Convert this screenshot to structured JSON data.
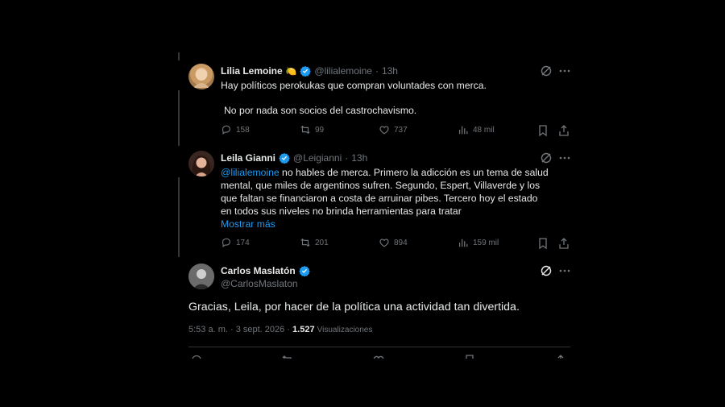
{
  "reply1": {
    "name": "Lilia Lemoine",
    "emoji": "🍋",
    "handle": "@lilialemoine",
    "dot": "·",
    "time": "13h",
    "line1": "Hay políticos perokukas que compran voluntades con merca.",
    "line2": "No por nada son socios del castrochavismo.",
    "replies": "158",
    "retweets": "99",
    "likes": "737",
    "views": "48 mil"
  },
  "reply2": {
    "name": "Leila Gianni",
    "handle": "@Leigianni",
    "dot": "·",
    "time": "13h",
    "mention": "@lilialemoine",
    "line1_rest": " no hables de merca. Primero la adicción es un tema de salud",
    "line2": "mental, que miles de argentinos sufren. Segundo, Espert, Villaverde y los",
    "line3": "que faltan se financiaron a costa de arruinar pibes. Tercero hoy el estado",
    "line4": "en todos sus niveles no brinda herramientas para tratar",
    "show_more": "Mostrar más",
    "replies": "174",
    "retweets": "201",
    "likes": "894",
    "views": "159 mil"
  },
  "main": {
    "name": "Carlos Maslatón",
    "handle": "@CarlosMaslaton",
    "text": "Gracias, Leila, por hacer de la política una actividad tan divertida.",
    "timestamp": "5:53 a. m. · 3 sept. 2026 ·",
    "views_count": "1.527",
    "views_label": "Visualizaciones"
  },
  "colors": {
    "background": "#000000",
    "text": "#e7e9ea",
    "muted": "#71767b",
    "accent": "#1d9bf0",
    "separator": "#2f3336"
  }
}
